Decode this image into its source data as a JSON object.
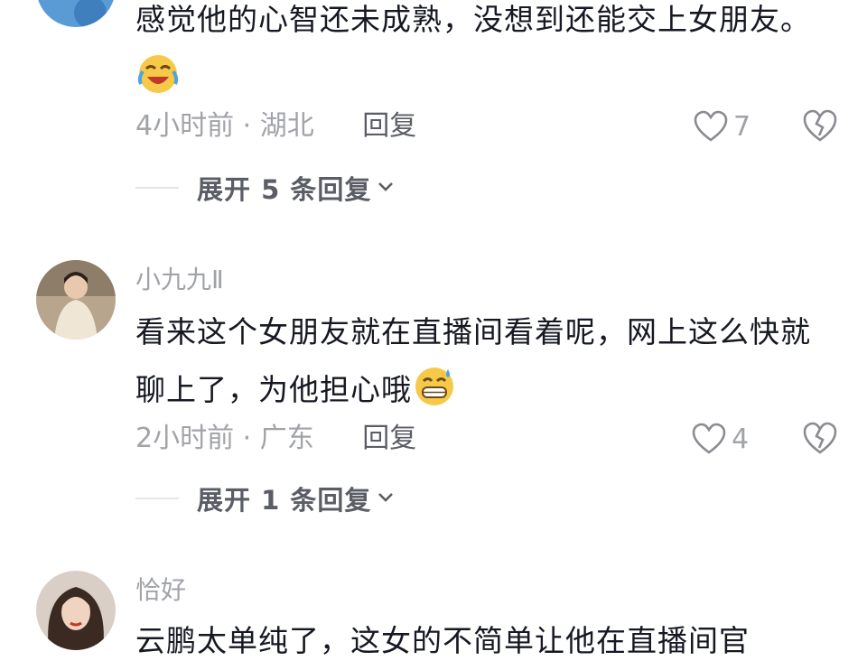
{
  "comments": [
    {
      "username": "",
      "text": "感觉他的心智还未成熟，没想到还能交上女朋友。",
      "emoji": "laugh-cry-emoji",
      "time_location": "4小时前 · 湖北",
      "reply_label": "回复",
      "likes": "7",
      "expand_label": "展开 5 条回复"
    },
    {
      "username": "小九九Ⅱ",
      "text": "看来这个女朋友就在直播间看着呢，网上这么快就聊上了，为他担心哦",
      "emoji": "grin-sweat-emoji",
      "time_location": "2小时前 · 广东",
      "reply_label": "回复",
      "likes": "4",
      "expand_label": "展开 1 条回复"
    },
    {
      "username": "恰好",
      "text": "云鹏太单纯了，这女的不简单让他在直播间官"
    }
  ],
  "colors": {
    "secondary_text": "#a1a3a8",
    "primary_text": "#161823",
    "reply_text": "#5b5d66",
    "icon_gray": "#8a8b91"
  }
}
